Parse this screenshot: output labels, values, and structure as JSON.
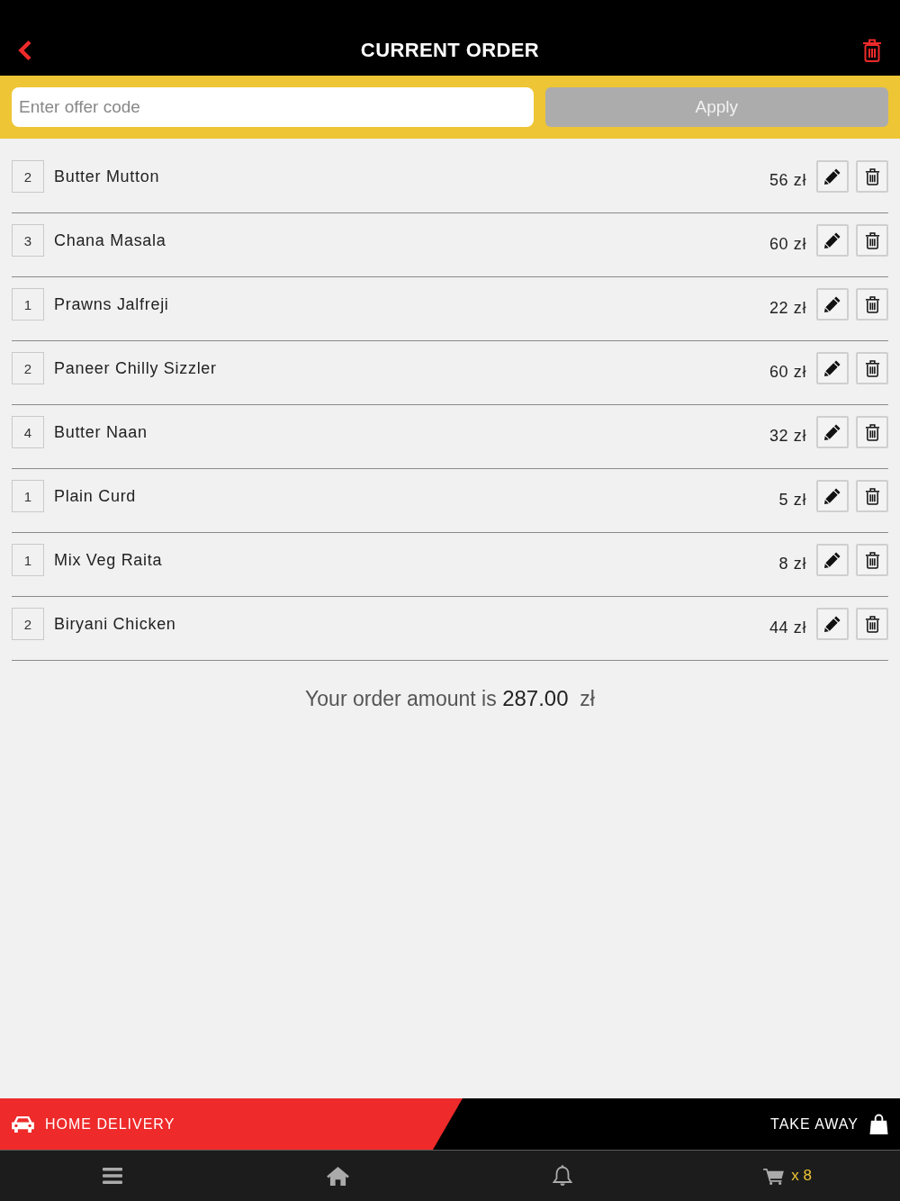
{
  "header": {
    "title": "CURRENT ORDER"
  },
  "offer": {
    "placeholder": "Enter offer code",
    "button": {
      "label": "Apply",
      "disabled": true
    }
  },
  "items": [
    {
      "qty": "2",
      "name": "Butter Mutton",
      "price": "56 zł"
    },
    {
      "qty": "3",
      "name": "Chana Masala",
      "price": "60 zł"
    },
    {
      "qty": "1",
      "name": "Prawns Jalfreji",
      "price": "22 zł"
    },
    {
      "qty": "2",
      "name": "Paneer Chilly Sizzler",
      "price": "60 zł"
    },
    {
      "qty": "4",
      "name": "Butter Naan",
      "price": "32 zł"
    },
    {
      "qty": "1",
      "name": "Plain Curd",
      "price": "5 zł"
    },
    {
      "qty": "1",
      "name": "Mix Veg Raita",
      "price": "8 zł"
    },
    {
      "qty": "2",
      "name": "Biryani Chicken",
      "price": "44 zł"
    }
  ],
  "total": {
    "text": "Your order amount is **287.00**  zł"
  },
  "delivery": {
    "options": [
      {
        "kind": "delivery",
        "label": "HOME DELIVERY",
        "selected": true
      },
      {
        "kind": "takeaway",
        "label": "TAKE AWAY",
        "selected": false
      }
    ]
  },
  "nav": [
    {
      "kind": "menu"
    },
    {
      "kind": "home"
    },
    {
      "kind": "notifications"
    },
    {
      "kind": "cart",
      "count": "x 8"
    }
  ]
}
